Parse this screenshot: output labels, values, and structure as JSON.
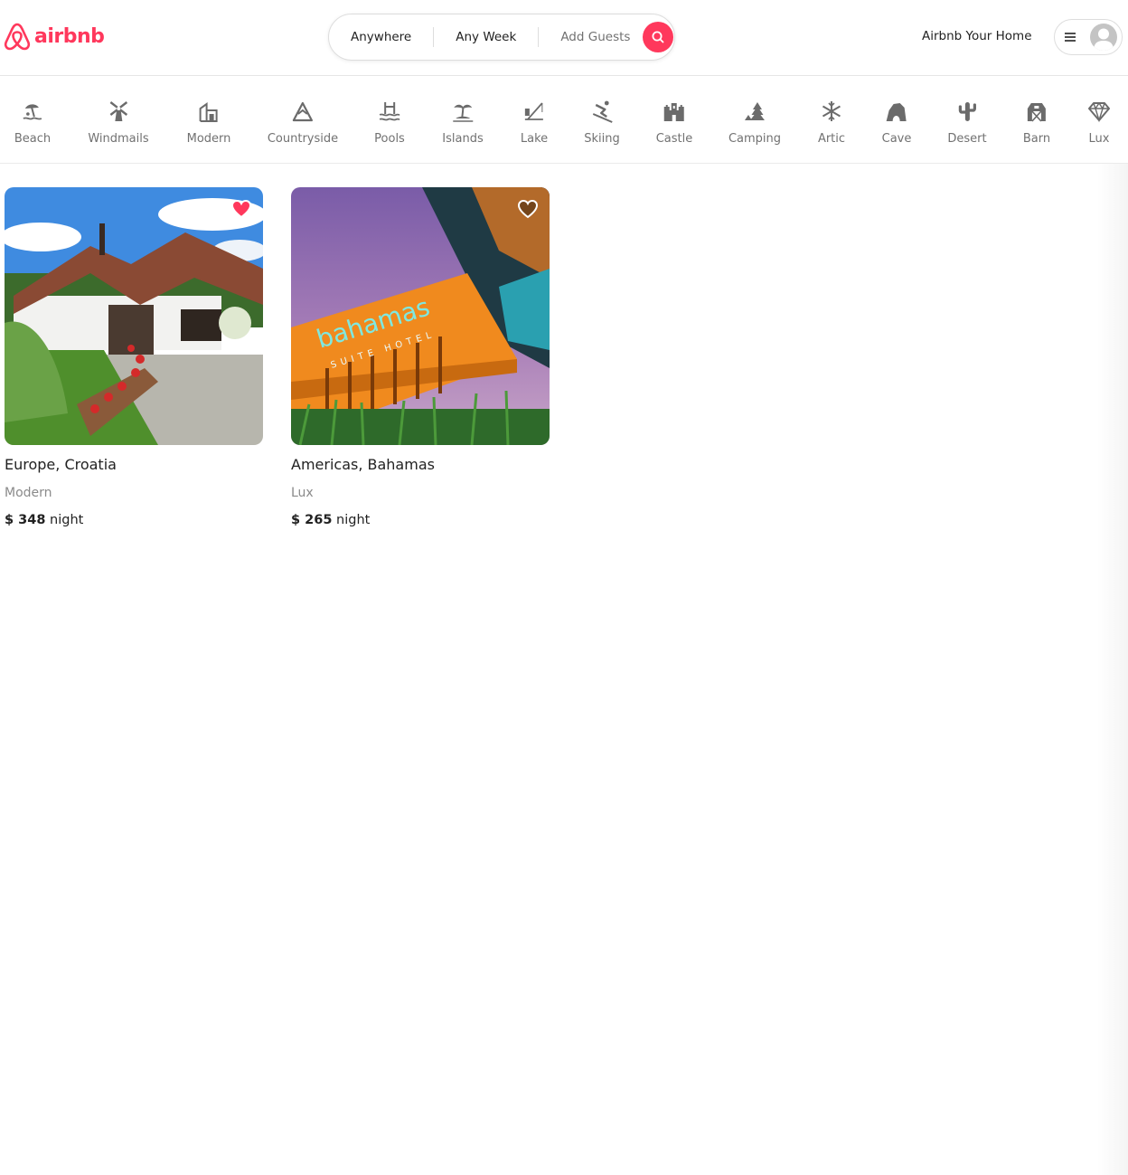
{
  "brand": {
    "name": "airbnb",
    "color": "#ff385c"
  },
  "search": {
    "where": "Anywhere",
    "when": "Any Week",
    "guests": "Add Guests",
    "button_icon": "search-icon"
  },
  "header": {
    "host_link": "Airbnb Your Home",
    "menu_icon": "hamburger-icon",
    "avatar_icon": "user-avatar-icon"
  },
  "categories": [
    {
      "label": "Beach",
      "icon": "beach-icon"
    },
    {
      "label": "Windmails",
      "icon": "windmill-icon"
    },
    {
      "label": "Modern",
      "icon": "modern-house-icon"
    },
    {
      "label": "Countryside",
      "icon": "mountain-icon"
    },
    {
      "label": "Pools",
      "icon": "pool-icon"
    },
    {
      "label": "Islands",
      "icon": "island-icon"
    },
    {
      "label": "Lake",
      "icon": "lake-fishing-icon"
    },
    {
      "label": "Skiing",
      "icon": "skiing-icon"
    },
    {
      "label": "Castle",
      "icon": "castle-icon"
    },
    {
      "label": "Camping",
      "icon": "camping-icon"
    },
    {
      "label": "Artic",
      "icon": "snowflake-icon"
    },
    {
      "label": "Cave",
      "icon": "cave-icon"
    },
    {
      "label": "Desert",
      "icon": "cactus-icon"
    },
    {
      "label": "Barn",
      "icon": "barn-icon"
    },
    {
      "label": "Lux",
      "icon": "diamond-icon"
    }
  ],
  "listings": [
    {
      "title": "Europe, Croatia",
      "category": "Modern",
      "price": "$ 348",
      "unit": "night",
      "favorited": true
    },
    {
      "title": "Americas, Bahamas",
      "category": "Lux",
      "price": "$ 265",
      "unit": "night",
      "favorited": false
    }
  ],
  "photo_signage": {
    "hotel_name": "bahamas",
    "hotel_sub": "SUITE HOTEL"
  }
}
